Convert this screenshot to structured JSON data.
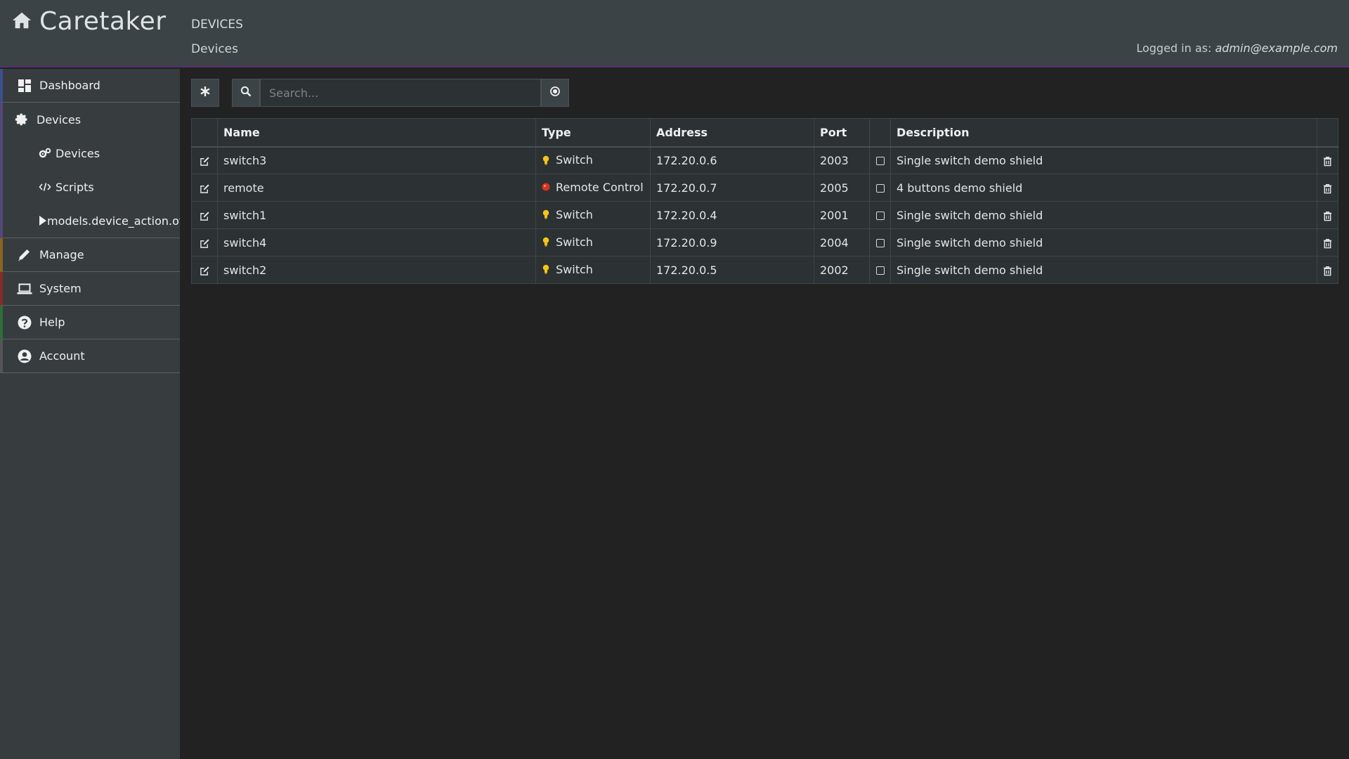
{
  "app": {
    "name": "Caretaker",
    "page_title": "DEVICES",
    "breadcrumb": "Devices",
    "logged_in_label": "Logged in as:",
    "logged_in_user": "admin@example.com",
    "accent_color": "#5b2f73"
  },
  "sidebar": {
    "items": [
      {
        "label": "Dashboard",
        "icon": "dashboard-icon"
      },
      {
        "label": "Devices",
        "icon": "gear-icon"
      },
      {
        "label": "Manage",
        "icon": "pencil-icon"
      },
      {
        "label": "System",
        "icon": "laptop-icon"
      },
      {
        "label": "Help",
        "icon": "question-icon"
      },
      {
        "label": "Account",
        "icon": "user-circle-icon"
      }
    ],
    "devices_sub": [
      {
        "label": "Devices",
        "icon": "gears-icon"
      },
      {
        "label": "Scripts",
        "icon": "code-icon"
      },
      {
        "label": "models.device_action.other",
        "icon": "play-icon"
      }
    ]
  },
  "toolbar": {
    "search_placeholder": "Search..."
  },
  "table": {
    "columns": [
      "",
      "Name",
      "Type",
      "Address",
      "Port",
      "",
      "Description",
      ""
    ],
    "rows": [
      {
        "name": "switch3",
        "type": "Switch",
        "type_icon": "lightbulb-icon",
        "address": "172.20.0.6",
        "port": "2003",
        "description": "Single switch demo shield"
      },
      {
        "name": "remote",
        "type": "Remote Control",
        "type_icon": "red-dot-icon",
        "address": "172.20.0.7",
        "port": "2005",
        "description": "4 buttons demo shield"
      },
      {
        "name": "switch1",
        "type": "Switch",
        "type_icon": "lightbulb-icon",
        "address": "172.20.0.4",
        "port": "2001",
        "description": "Single switch demo shield"
      },
      {
        "name": "switch4",
        "type": "Switch",
        "type_icon": "lightbulb-icon",
        "address": "172.20.0.9",
        "port": "2004",
        "description": "Single switch demo shield"
      },
      {
        "name": "switch2",
        "type": "Switch",
        "type_icon": "lightbulb-icon",
        "address": "172.20.0.5",
        "port": "2002",
        "description": "Single switch demo shield"
      }
    ]
  }
}
